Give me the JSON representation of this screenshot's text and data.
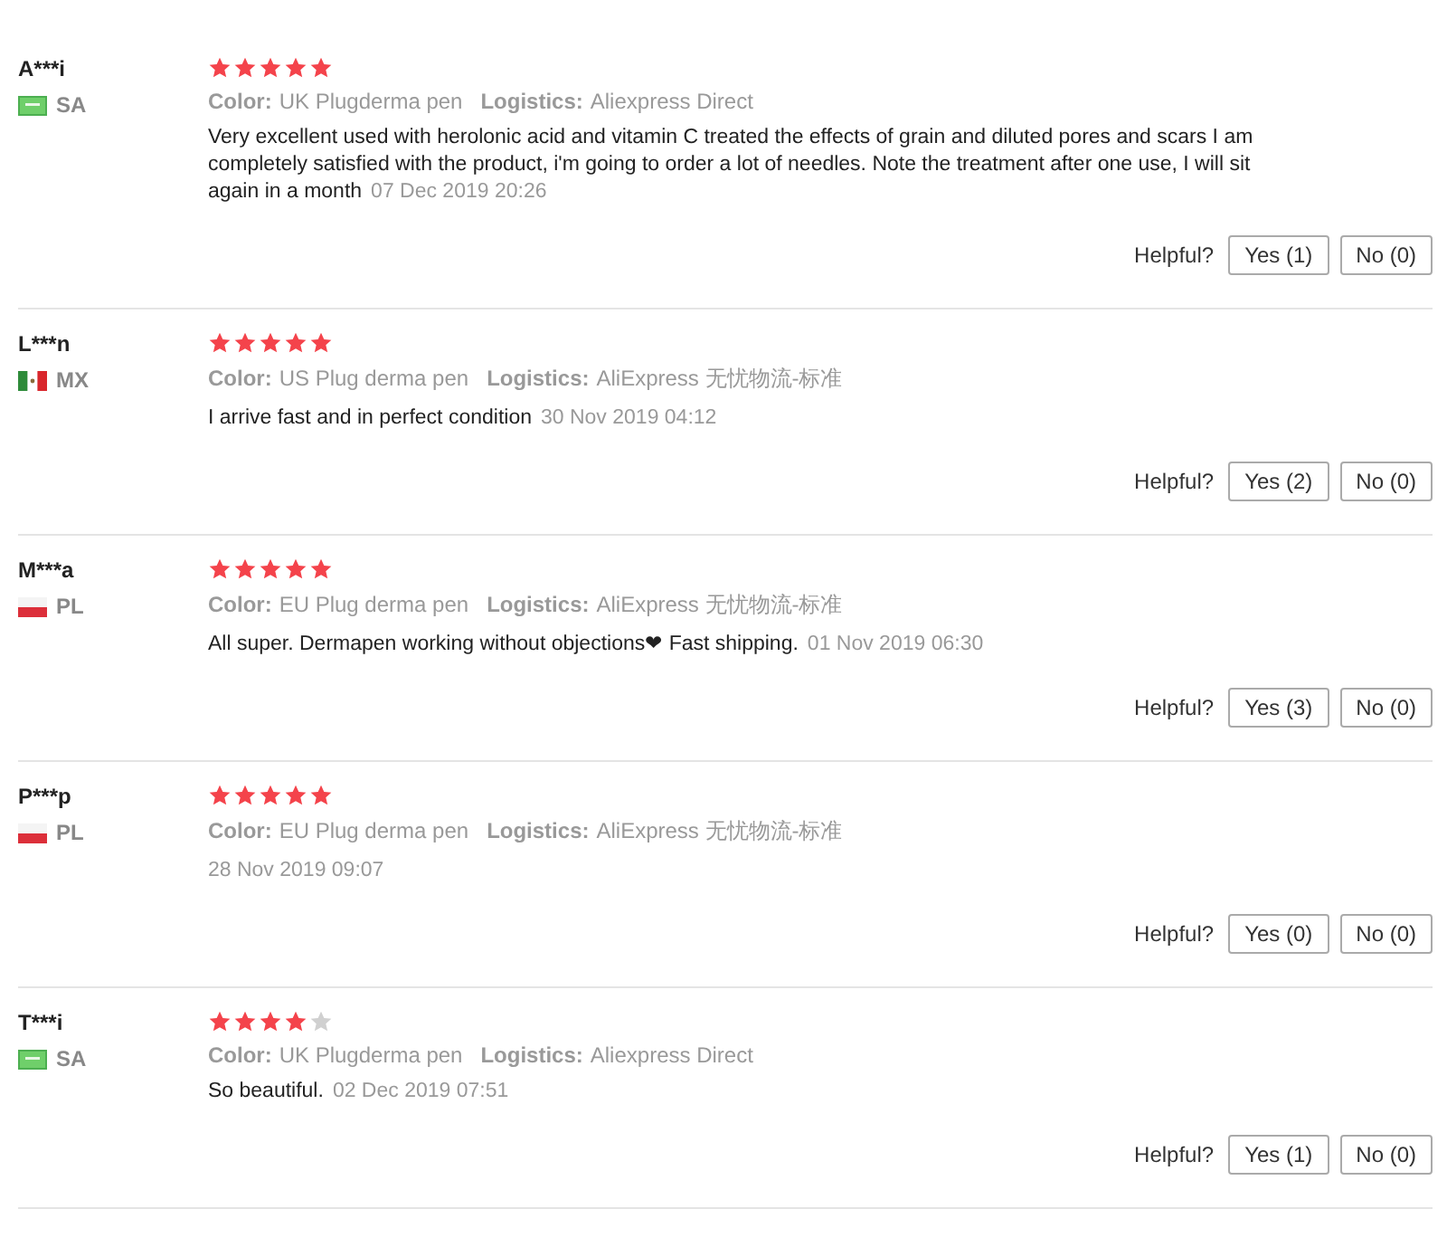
{
  "reviews": [
    {
      "name": "A***i",
      "kind": "sa",
      "country": "SA",
      "stars": 5,
      "color_label": "Color:",
      "variant": "UK Plugderma pen",
      "logistics_label": "Logistics:",
      "logistics": "Aliexpress Direct",
      "comment": "Very excellent used with herolonic acid and vitamin C treated the effects of grain and diluted pores and scars I am completely satisfied with the product, i'm going to order a lot of needles. Note the treatment after one use, I will sit again in a month",
      "date": "07 Dec 2019 20:26",
      "helpful": "Helpful?",
      "yes": "Yes (1)",
      "no": "No (0)"
    },
    {
      "name": "L***n",
      "kind": "mx",
      "country": "MX",
      "stars": 5,
      "color_label": "Color:",
      "variant": "US Plug derma pen",
      "logistics_label": "Logistics:",
      "logistics": "AliExpress 无忧物流-标准",
      "comment": "I arrive fast and in perfect condition",
      "date": "30 Nov 2019 04:12",
      "helpful": "Helpful?",
      "yes": "Yes (2)",
      "no": "No (0)"
    },
    {
      "name": "M***a",
      "kind": "pl",
      "country": "PL",
      "stars": 5,
      "color_label": "Color:",
      "variant": "EU Plug derma pen",
      "logistics_label": "Logistics:",
      "logistics": "AliExpress 无忧物流-标准",
      "comment": "All super. Dermapen working without objections❤ Fast shipping.",
      "date": "01 Nov 2019 06:30",
      "helpful": "Helpful?",
      "yes": "Yes (3)",
      "no": "No (0)"
    },
    {
      "name": "P***p",
      "kind": "pl",
      "country": "PL",
      "stars": 5,
      "color_label": "Color:",
      "variant": "EU Plug derma pen",
      "logistics_label": "Logistics:",
      "logistics": "AliExpress 无忧物流-标准",
      "date": "28 Nov 2019 09:07",
      "helpful": "Helpful?",
      "yes": "Yes (0)",
      "no": "No (0)"
    },
    {
      "name": "T***i",
      "kind": "sa",
      "country": "SA",
      "stars": 4,
      "color_label": "Color:",
      "variant": "UK Plugderma pen",
      "logistics_label": "Logistics:",
      "logistics": "Aliexpress Direct",
      "comment": "So beautiful.",
      "date": "02 Dec 2019 07:51",
      "helpful": "Helpful?",
      "yes": "Yes (1)",
      "no": "No (0)"
    }
  ]
}
